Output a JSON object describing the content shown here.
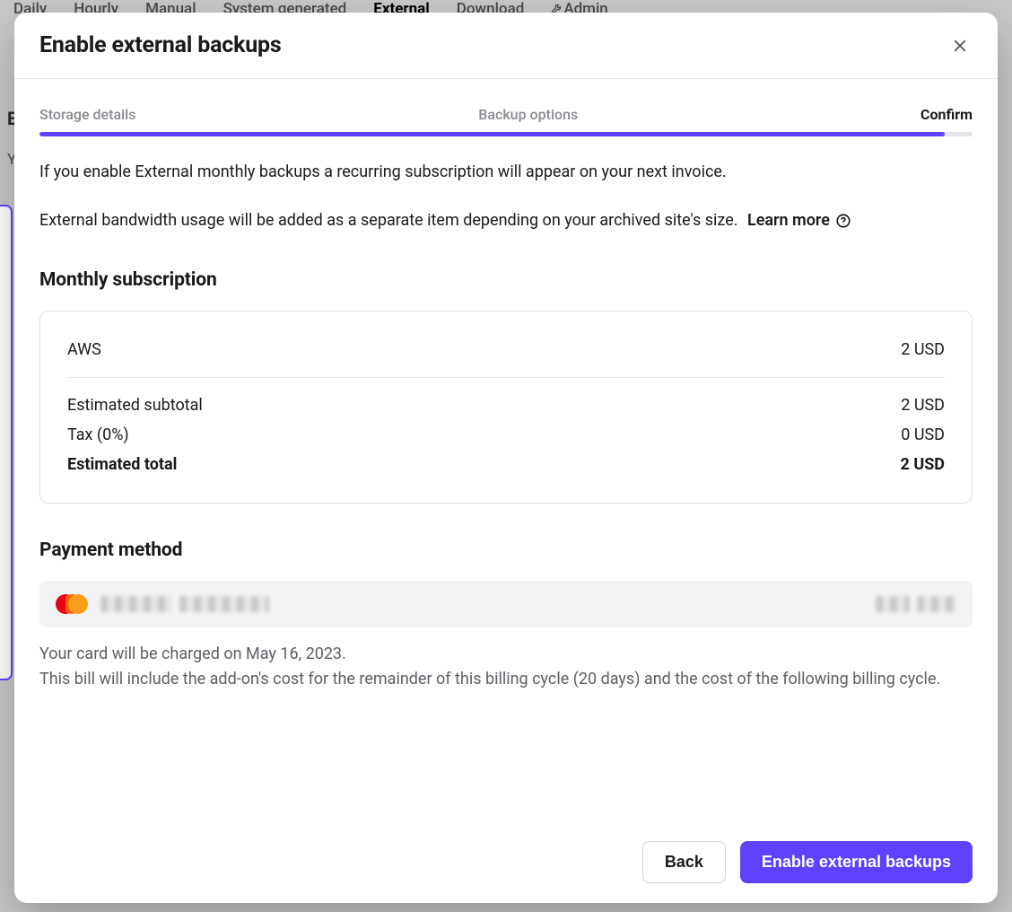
{
  "bg_tabs": {
    "daily": "Daily",
    "hourly": "Hourly",
    "manual": "Manual",
    "system": "System generated",
    "external": "External",
    "download": "Download",
    "admin": "Admin"
  },
  "modal": {
    "title": "Enable external backups",
    "steps": {
      "storage": "Storage details",
      "options": "Backup options",
      "confirm": "Confirm"
    },
    "desc1": "If you enable External monthly backups a recurring subscription will appear on your next invoice.",
    "desc2": "External bandwidth usage will be added as a separate item depending on your archived site's size.",
    "learn_more": "Learn more",
    "subscription_title": "Monthly subscription",
    "rows": {
      "aws_label": "AWS",
      "aws_value": "2 USD",
      "subtotal_label": "Estimated subtotal",
      "subtotal_value": "2 USD",
      "tax_label": "Tax (0%)",
      "tax_value": "0 USD",
      "total_label": "Estimated total",
      "total_value": "2 USD"
    },
    "payment_title": "Payment method",
    "note1": "Your card will be charged on May 16, 2023.",
    "note2": "This bill will include the add-on's cost for the remainder of this billing cycle (20 days) and the cost of the following billing cycle.",
    "back": "Back",
    "submit": "Enable external backups"
  }
}
